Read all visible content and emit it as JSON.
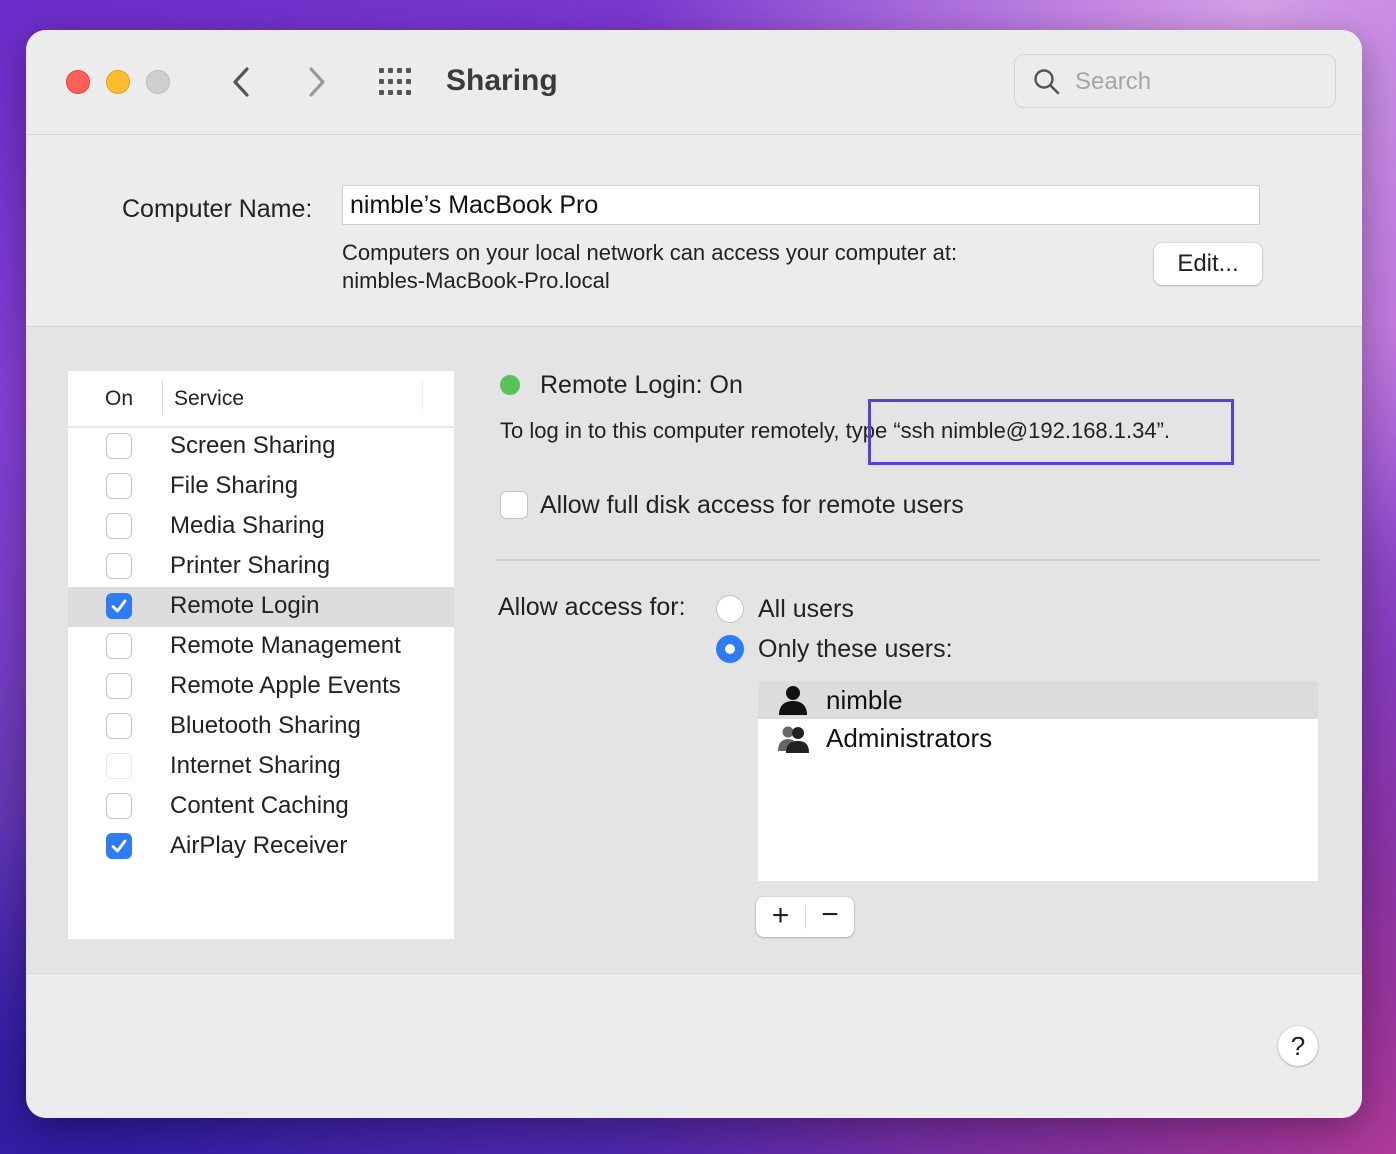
{
  "window": {
    "title": "Sharing",
    "search_placeholder": "Search"
  },
  "computer": {
    "name_label": "Computer Name:",
    "name_value": "nimble’s MacBook Pro",
    "desc_line1": "Computers on your local network can access your computer at:",
    "desc_line2": "nimbles-MacBook-Pro.local",
    "edit_label": "Edit..."
  },
  "services": {
    "header_on": "On",
    "header_service": "Service",
    "items": [
      {
        "label": "Screen Sharing",
        "checked": false
      },
      {
        "label": "File Sharing",
        "checked": false
      },
      {
        "label": "Media Sharing",
        "checked": false
      },
      {
        "label": "Printer Sharing",
        "checked": false
      },
      {
        "label": "Remote Login",
        "checked": true,
        "selected": true
      },
      {
        "label": "Remote Management",
        "checked": false
      },
      {
        "label": "Remote Apple Events",
        "checked": false
      },
      {
        "label": "Bluetooth Sharing",
        "checked": false
      },
      {
        "label": "Internet Sharing",
        "checked": false,
        "disabled": true
      },
      {
        "label": "Content Caching",
        "checked": false
      },
      {
        "label": "AirPlay Receiver",
        "checked": true
      }
    ]
  },
  "detail": {
    "status": "Remote Login: On",
    "status_color": "#5ac05a",
    "login_instruction": "To log in to this computer remotely, type “ssh nimble@192.168.1.34”.",
    "full_disk_label": "Allow full disk access for remote users",
    "full_disk_checked": false,
    "access_label": "Allow access for:",
    "radio_all": "All users",
    "radio_only": "Only these users:",
    "selected_radio": "only",
    "users": [
      {
        "name": "nimble",
        "icon": "single-user-icon",
        "selected": true
      },
      {
        "name": "Administrators",
        "icon": "group-users-icon",
        "selected": false
      }
    ],
    "add_label": "+",
    "remove_label": "−"
  },
  "help_label": "?",
  "colors": {
    "accent": "#2f7bf5",
    "highlight_box": "#5a3fe0"
  }
}
